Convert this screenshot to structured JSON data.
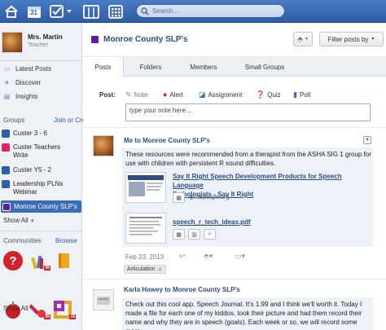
{
  "topbar": {
    "search_placeholder": "Search...",
    "calendar_day": "31",
    "colors": {
      "bar": "#3a68b4"
    }
  },
  "sidebar": {
    "user_name": "Mrs. Martin",
    "user_role": "Teacher",
    "links": [
      {
        "label": "Latest Posts",
        "icon": "speech-bubble-icon"
      },
      {
        "label": "Discover",
        "icon": "compass-icon"
      },
      {
        "label": "Insights",
        "icon": "chart-icon"
      }
    ],
    "groups_header": "Groups",
    "groups_join": "Join or Create",
    "groups": [
      {
        "label": "Custer 3 - 6",
        "color": "#2f5ea8"
      },
      {
        "label": "Custer Teachers Write",
        "color": "#e0206a"
      },
      {
        "label": "Custer Y5 - 2",
        "color": "#2f5ea8"
      },
      {
        "label": "Leadership PLNs Webinar",
        "color": "#2f5ea8"
      },
      {
        "label": "Monroe County SLP's",
        "color": "#5a1fa8"
      }
    ],
    "show_all_groups": "Show All",
    "communities_header": "Communities",
    "communities_browse": "Browse",
    "show_all_communities": "Show All",
    "community_badges": [
      "96",
      "96",
      "16"
    ]
  },
  "main": {
    "group_title": "Monroe County SLP's",
    "filter_label": "Filter posts by",
    "tabs": [
      "Posts",
      "Folders",
      "Members",
      "Small Groups"
    ],
    "composer": {
      "post_label": "Post:",
      "types": [
        "Note",
        "Alert",
        "Assignment",
        "Quiz",
        "Poll"
      ],
      "note_placeholder": "type your note here..."
    },
    "posts": [
      {
        "header_prefix": "Me to ",
        "header_group": "Monroe County SLP's",
        "text": [
          "These resources were recommended from a therapist from the ASHA SIG 1 group for",
          "use with children with persistent R sound difficulties."
        ],
        "attachments": [
          {
            "title_lines": [
              "Say It Right Speech Development Products for Speech Language",
              "Pathologists - Say It Right"
            ],
            "domain": "sayitright.org"
          },
          {
            "title_lines": [
              "speech_r_tech_ideas.pdf"
            ],
            "domain": ""
          }
        ],
        "date": "Feb 23, 2013",
        "tag": "Articulation"
      },
      {
        "header_prefix": "Karla Howey to ",
        "header_group": "Monroe County SLP's",
        "text": [
          "Check out this cool app. Speech Journal. It's 1.99 and I think we'll worth it. Today I",
          "made a file for each one of my kiddos, took their picture and had them record their",
          "name and why they are in speech (goals). Each week or so, we will record some more"
        ]
      }
    ]
  }
}
